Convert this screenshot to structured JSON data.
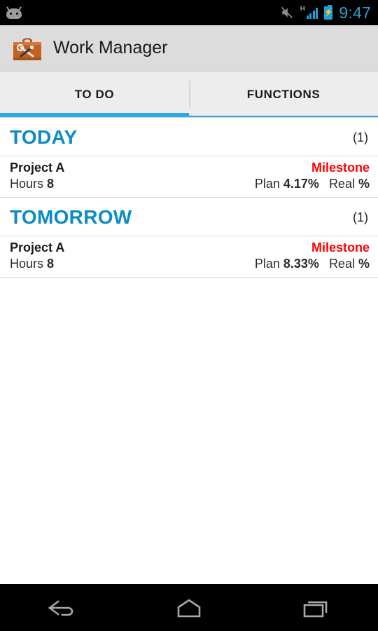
{
  "status_bar": {
    "app_notification_icon": "android-robot-icon",
    "icons": [
      "vibrate-off-icon",
      "signal-h-icon",
      "battery-charging-icon"
    ],
    "network_label": "H",
    "time": "9:47"
  },
  "app_bar": {
    "icon": "toolbox-app-icon",
    "title": "Work Manager"
  },
  "tabs": [
    {
      "label": "TO DO",
      "active": true
    },
    {
      "label": "FUNCTIONS",
      "active": false
    }
  ],
  "groups": [
    {
      "title": "TODAY",
      "count": "(1)",
      "tasks": [
        {
          "name": "Project A",
          "tag": "Milestone",
          "hours_label": "Hours",
          "hours_value": "8",
          "plan_label": "Plan",
          "plan_value": "4.17%",
          "real_label": "Real",
          "real_value": "%"
        }
      ]
    },
    {
      "title": "TOMORROW",
      "count": "(1)",
      "tasks": [
        {
          "name": "Project A",
          "tag": "Milestone",
          "hours_label": "Hours",
          "hours_value": "8",
          "plan_label": "Plan",
          "plan_value": "8.33%",
          "real_label": "Real",
          "real_value": "%"
        }
      ]
    }
  ],
  "nav_bar": {
    "buttons": [
      "back-icon",
      "home-icon",
      "recents-icon"
    ]
  },
  "colors": {
    "accent_blue": "#29abe2",
    "header_blue": "#0b8cc4",
    "tag_red": "#ff0000",
    "app_bar_bg": "#dcdcdc",
    "tab_bar_bg": "#ededed",
    "status_bar_bg": "#000000",
    "status_time": "#2f9fd0",
    "toolbox_orange": "#c4621f"
  }
}
